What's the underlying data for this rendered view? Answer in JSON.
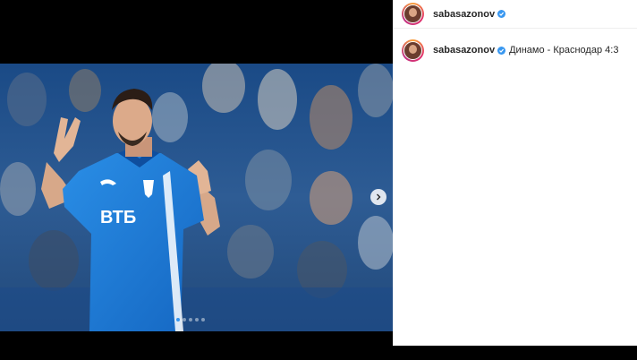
{
  "post": {
    "username": "sabasazonov",
    "caption": "Динамо - Краснодар 4:3",
    "sponsor_text": "ВТБ",
    "slide_count": 5,
    "active_slide": 1
  },
  "colors": {
    "verified": "#3897f0",
    "jersey": "#1e7fd6"
  }
}
